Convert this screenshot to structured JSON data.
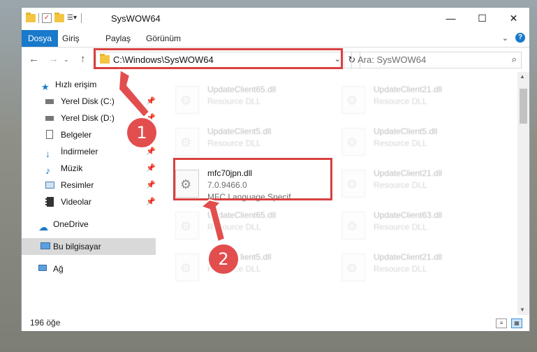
{
  "window": {
    "title": "SysWOW64",
    "controls": {
      "minimize": "—",
      "maximize": "☐",
      "close": "✕"
    }
  },
  "ribbon": {
    "tabs": [
      "Dosya",
      "Giriş",
      "Paylaş",
      "Görünüm"
    ],
    "file_tab_color": "#1979ca",
    "collapse_icon": "chevron-down-icon",
    "help_label": "?"
  },
  "address_bar": {
    "path": "C:\\Windows\\SysWOW64",
    "refresh_label": "↻",
    "search_placeholder": "Ara: SysWOW64"
  },
  "nav": {
    "items": [
      {
        "label": "Hızlı erişim",
        "icon": "star-icon"
      },
      {
        "label": "Yerel Disk (C:)",
        "icon": "drive-icon",
        "pinned": true
      },
      {
        "label": "Yerel Disk (D:)",
        "icon": "drive-icon",
        "pinned": true
      },
      {
        "label": "Belgeler",
        "icon": "document-icon",
        "pinned": true
      },
      {
        "label": "İndirmeler",
        "icon": "download-icon",
        "pinned": true
      },
      {
        "label": "Müzik",
        "icon": "music-icon",
        "pinned": true
      },
      {
        "label": "Resimler",
        "icon": "pictures-icon",
        "pinned": true
      },
      {
        "label": "Videolar",
        "icon": "video-icon",
        "pinned": true
      },
      {
        "label": "OneDrive",
        "icon": "cloud-icon"
      },
      {
        "label": "Bu bilgisayar",
        "icon": "computer-icon",
        "selected": true
      },
      {
        "label": "Ağ",
        "icon": "network-icon"
      }
    ]
  },
  "files": [
    {
      "name": "UpdateClient65.dll",
      "desc": "Resource DLL",
      "faded": true
    },
    {
      "name": "UpdateClient21.dll",
      "desc": "Resource DLL",
      "faded": true
    },
    {
      "name": "UpdateClient5.dll",
      "desc": "Resource DLL",
      "faded": true
    },
    {
      "name": "UpdateClient5.dll",
      "desc": "Resource DLL",
      "faded": true
    },
    {
      "name": "mfc70jpn.dll",
      "version": "7.0.9466.0",
      "desc": "MFC Language Specif...",
      "faded": false
    },
    {
      "name": "UpdateClient21.dll",
      "desc": "Resource DLL",
      "faded": true
    },
    {
      "name": "UpdateClient65.dll",
      "desc": "Resource DLL",
      "faded": true
    },
    {
      "name": "UpdateClient63.dll",
      "desc": "Resource DLL",
      "faded": true
    },
    {
      "name": "UpdateClient5.dll",
      "desc": "Resource DLL",
      "faded": true
    },
    {
      "name": "UpdateClient21.dll",
      "desc": "Resource DLL",
      "faded": true
    }
  ],
  "status": {
    "count": "196 öğe"
  },
  "callouts": [
    "1",
    "2"
  ],
  "colors": {
    "highlight": "#d94040",
    "callout": "#e24e4e",
    "selection": "#d9d9d9"
  }
}
